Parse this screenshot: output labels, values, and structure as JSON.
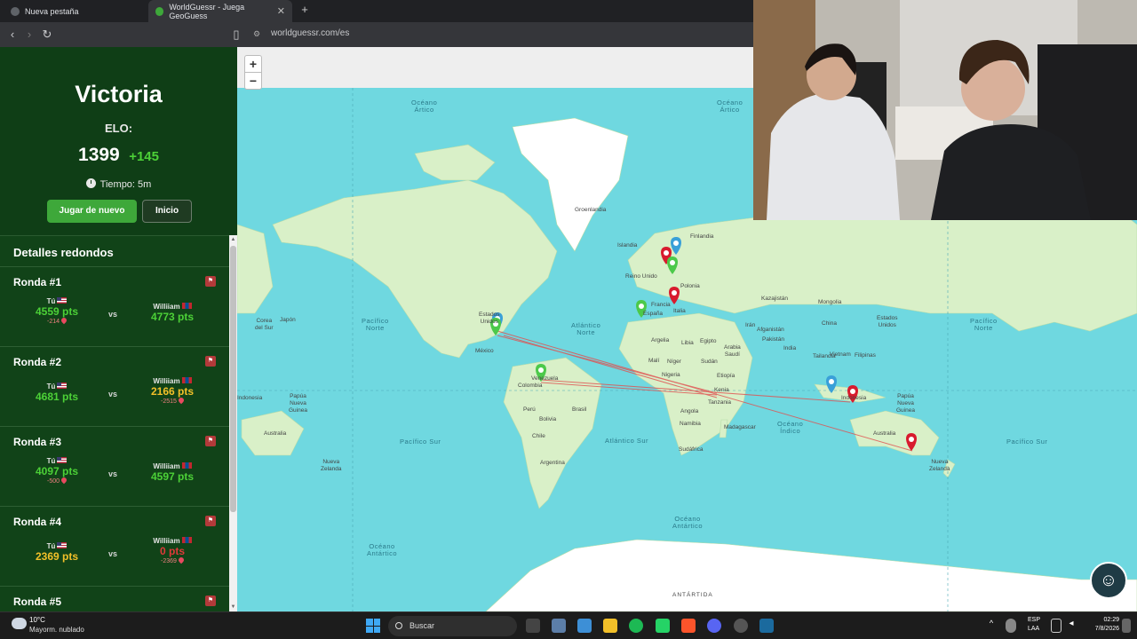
{
  "browser": {
    "tabs": [
      {
        "label": "Nueva pestaña"
      },
      {
        "label": "WorldGuessr - Juega GeoGuess"
      }
    ],
    "url": "worldguessr.com/es"
  },
  "result": {
    "title": "Victoria",
    "elo_label": "ELO:",
    "elo_value": "1399",
    "elo_delta": "+145",
    "time_label": "Tiempo: 5m",
    "play_again": "Jugar de nuevo",
    "home": "Inicio"
  },
  "details": {
    "title": "Detalles redondos",
    "vs": "vs",
    "player1": "Tú",
    "player2": "Williiam",
    "rounds": [
      {
        "title": "Ronda #1",
        "p1_pts": "4559 pts",
        "p1_delta": "-214",
        "p2_pts": "4773 pts",
        "p2_delta": ""
      },
      {
        "title": "Ronda #2",
        "p1_pts": "4681 pts",
        "p1_delta": "",
        "p2_pts": "2166 pts",
        "p2_delta": "-2515"
      },
      {
        "title": "Ronda #3",
        "p1_pts": "4097 pts",
        "p1_delta": "-500",
        "p2_pts": "4597 pts",
        "p2_delta": ""
      },
      {
        "title": "Ronda #4",
        "p1_pts": "2369 pts",
        "p1_delta": "",
        "p2_pts": "0 pts",
        "p2_delta": "-2369"
      },
      {
        "title": "Ronda #5"
      }
    ]
  },
  "map": {
    "zoom_in": "+",
    "zoom_out": "−",
    "labels": {
      "oceano_artico_1": "Océano\nÁrtico",
      "oceano_artico_2": "Océano\nÁrtico",
      "groenlandia": "Groenlandia",
      "islandia": "Islandia",
      "finlandia": "Finlandia",
      "reino_unido": "Reino Unido",
      "francia": "Francia",
      "espana": "España",
      "polonia": "Polonia",
      "italia": "Italia",
      "mongolia": "Mongolia",
      "kazajistan": "Kazajistán",
      "estados_unidos": "Estados\nUnidos",
      "mexico": "México",
      "japon": "Japón",
      "corea_del_sur": "Corea\ndel Sur",
      "pacifico_norte_1": "Pacífico\nNorte",
      "pacifico_norte_2": "Pacífico\nNorte",
      "atlantico_norte": "Atlántico\nNorte",
      "argelia": "Argelia",
      "libia": "Libia",
      "egipto": "Egipto",
      "mali": "Malí",
      "niger": "Níger",
      "sudan": "Sudán",
      "nigeria": "Nigeria",
      "etiopia": "Etiopía",
      "kenia": "Kenia",
      "tanzania": "Tanzania",
      "arabia_saudi": "Arabia\nSaudí",
      "iran": "Irán",
      "afganistan": "Afganistán",
      "pakistan": "Pakistán",
      "india": "India",
      "china": "China",
      "venezuela": "Venezuela",
      "colombia": "Colombia",
      "peru": "Perú",
      "bolivia": "Bolivia",
      "brasil": "Brasil",
      "chile": "Chile",
      "argentina": "Argentina",
      "angola": "Angola",
      "namibia": "Namibia",
      "sudafrica": "Sudáfrica",
      "madagascar": "Madagascar",
      "indonesia_1": "Indonesia",
      "indonesia_2": "Indonesia",
      "papua": "Papúa\nNueva\nGuinea",
      "papua_2": "Papúa\nNueva\nGuinea",
      "australia_1": "Australia",
      "australia_2": "Australia",
      "nueva_zelanda_1": "Nueva\nZelanda",
      "nueva_zelanda_2": "Nueva\nZelanda",
      "pacifico_sur_1": "Pacífico Sur",
      "pacifico_sur_2": "Pacífico Sur",
      "atlantico_sur": "Atlántico Sur",
      "oceano_indico": "Océano\nÍndico",
      "oceano_antartico_1": "Océano\nAntártico",
      "oceano_antartico_2": "Océano\nAntártico",
      "antartida": "ANTÁRTIDA",
      "estados_unidos_2": "Estados\nUnidos",
      "vietnam": "Vietnam",
      "tailandia": "Tailandia",
      "filipinas": "Filipinas"
    },
    "colors": {
      "ocean": "#6fd8e0",
      "land": "#d9f0c8",
      "ice": "#ffffff",
      "pin_you": "#4cc94a",
      "pin_opponent": "#d81b2e",
      "pin_answer": "#3aa0d8",
      "line": "#e05050"
    }
  },
  "taskbar": {
    "temp": "10°C",
    "weather": "Mayorm. nublado",
    "search": "Buscar",
    "lang1": "ESP",
    "lang2": "LAA",
    "time": "02:29",
    "date": "7/8/2026"
  }
}
